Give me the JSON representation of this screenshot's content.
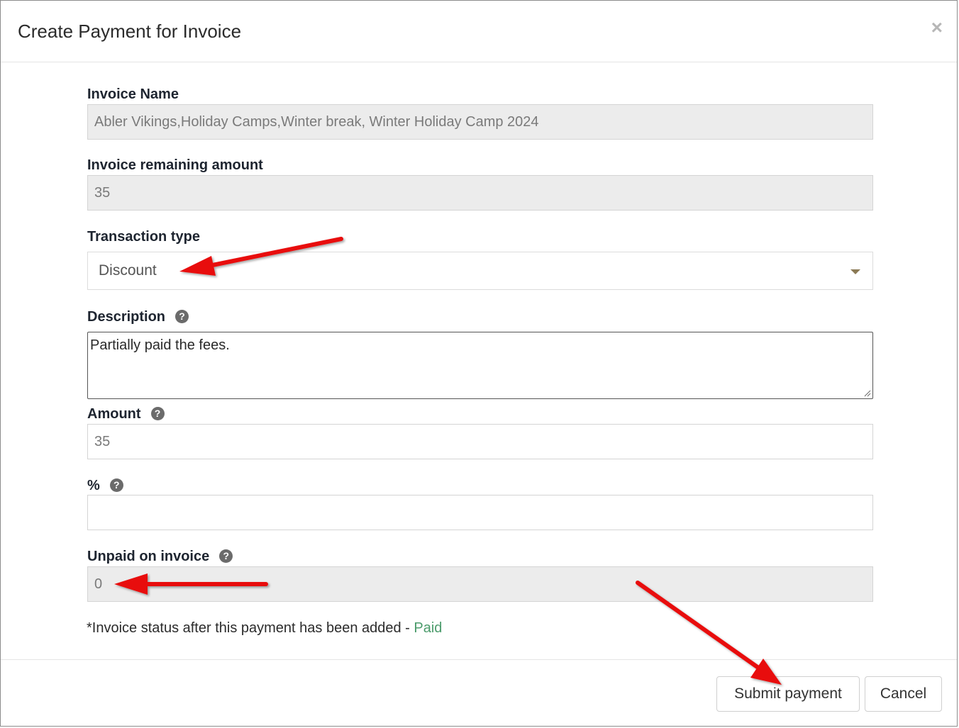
{
  "dialog": {
    "title": "Create Payment for Invoice",
    "close_glyph": "×"
  },
  "fields": {
    "invoice_name": {
      "label": "Invoice Name",
      "value": "Abler Vikings,Holiday Camps,Winter break, Winter Holiday Camp 2024"
    },
    "remaining_amount": {
      "label": "Invoice remaining amount",
      "value": "35"
    },
    "transaction_type": {
      "label": "Transaction type",
      "selected": "Discount"
    },
    "description": {
      "label": "Description",
      "value": "Partially paid the fees."
    },
    "amount": {
      "label": "Amount",
      "value": "35"
    },
    "percent": {
      "label": "%",
      "value": ""
    },
    "unpaid": {
      "label": "Unpaid on invoice",
      "value": "0"
    }
  },
  "status": {
    "prefix": "*Invoice status after this payment has been added - ",
    "value": "Paid",
    "value_color": "#4b9b6b"
  },
  "footer": {
    "submit_label": "Submit payment",
    "cancel_label": "Cancel"
  },
  "help_icon_glyph": "?",
  "annotation_color": "#e8110f"
}
